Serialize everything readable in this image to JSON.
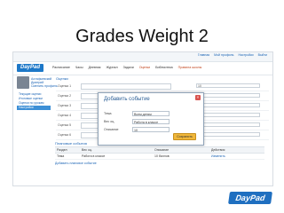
{
  "slide": {
    "title": "Grades Weight 2"
  },
  "topbar": {
    "links": [
      "Главная",
      "Мой профиль",
      "Настройки",
      "Выйти"
    ]
  },
  "header": {
    "logo": "DayPad",
    "nav": [
      "Расписание",
      "Часы",
      "Дневник",
      "Журнал",
      "Задачи",
      "Оценки",
      "Библиотека",
      "Правила школы"
    ],
    "nav_active": 5
  },
  "profile": {
    "name": "Астафьевский Дмитрий",
    "sub": "Сменить профиль"
  },
  "sidebar": {
    "items": [
      "Текущие оценки",
      "Итоговые оценки",
      "Оценки по урокам",
      "Настройки"
    ],
    "active": 3
  },
  "main": {
    "section_title": "Оценки",
    "rows": [
      {
        "label": "Оценка 1",
        "value": "10"
      },
      {
        "label": "Оценка 2",
        "value": "+10"
      },
      {
        "label": "Оценка 3",
        "value": "+10"
      },
      {
        "label": "Оценка 4",
        "value": "+10"
      },
      {
        "label": "Оценка 5",
        "value": "+10"
      },
      {
        "label": "Оценка 6",
        "value": "+10"
      }
    ]
  },
  "events": {
    "title": "Плановые события",
    "headers": [
      "Раздел",
      "Вес оц.",
      "Описание",
      "Действия"
    ],
    "rows": [
      {
        "col1": "Тема",
        "col2": "Работа в классе",
        "col3": "10 баллов",
        "action": "Изменить"
      }
    ],
    "add_link": "Добавить плановое событие"
  },
  "modal": {
    "title": "Добавить событие",
    "fields": [
      {
        "label": "Тема",
        "value": "Всем детям"
      },
      {
        "label": "Вес оц.",
        "value": "Работа в классе"
      },
      {
        "label": "Описание",
        "value": "10"
      }
    ],
    "save_label": "Сохранить",
    "close_glyph": "×"
  },
  "colors": {
    "accent": "#1d78c8",
    "button": "#f0b73b",
    "link": "#1b64b5"
  },
  "brand_logo": "DayPad"
}
